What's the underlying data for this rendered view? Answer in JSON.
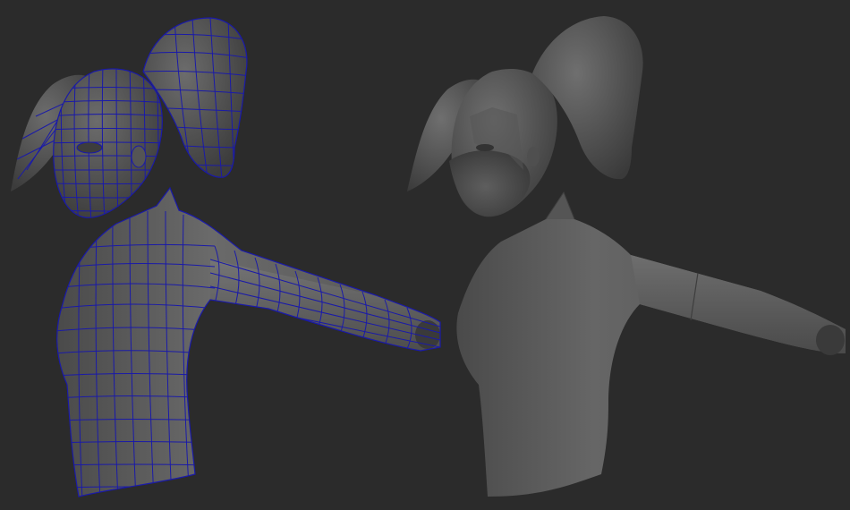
{
  "viewport": {
    "background": "#2b2b2b"
  },
  "models": [
    {
      "name": "wireframe-on-shaded",
      "surface_color": "#5f5f5f",
      "wire_color": "#1a1aa8",
      "icon": "character-bust-wireframe"
    },
    {
      "name": "smooth-shaded",
      "surface_color": "#5e5e5e",
      "icon": "character-bust-shaded"
    }
  ]
}
